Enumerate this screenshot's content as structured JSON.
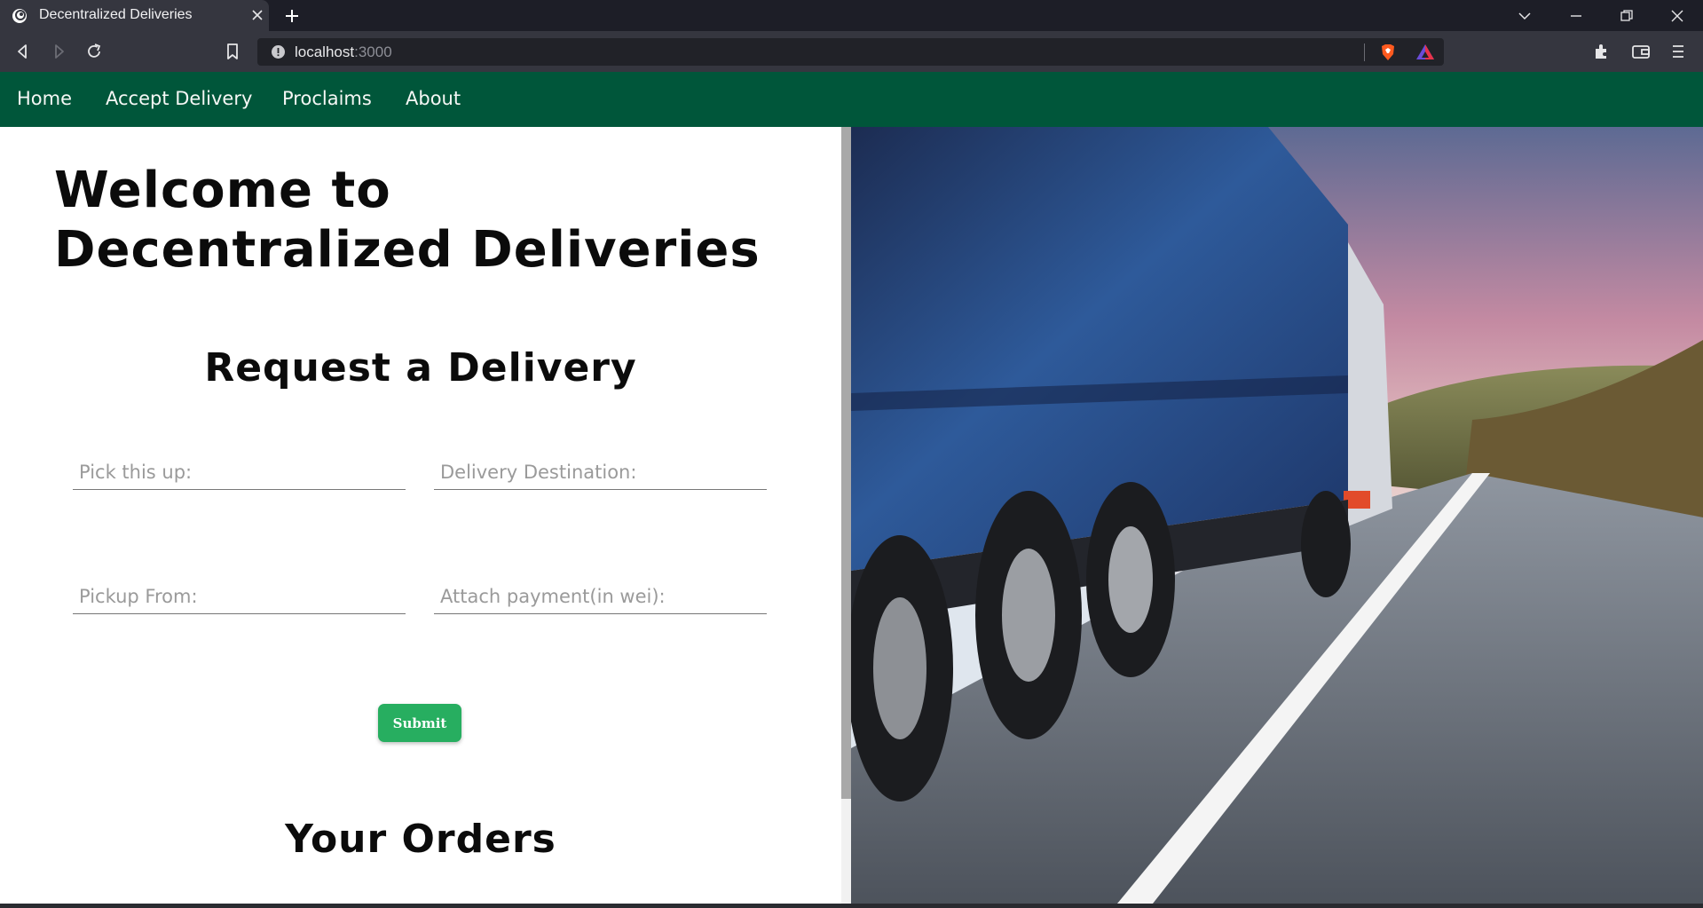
{
  "browser": {
    "tab_title": "Decentralized Deliveries",
    "url_host": "localhost",
    "url_port": ":3000",
    "icons": [
      "favicon-icon",
      "close-icon",
      "plus-icon",
      "chevron-down-icon",
      "minimize-icon",
      "restore-icon",
      "close-window-icon",
      "back-icon",
      "forward-icon",
      "reload-icon",
      "bookmark-icon",
      "info-icon",
      "brave-shield-icon",
      "brave-rewards-icon",
      "extensions-icon",
      "wallet-icon",
      "menu-icon"
    ]
  },
  "nav": {
    "items": [
      "Home",
      "Accept Delivery",
      "Proclaims",
      "About"
    ]
  },
  "page": {
    "welcome": "Welcome to Decentralized Deliveries",
    "request_title": "Request a Delivery",
    "orders_title": "Your Orders"
  },
  "form": {
    "pickup_item_placeholder": "Pick this up:",
    "pickup_item_value": "",
    "destination_placeholder": "Delivery Destination:",
    "destination_value": "",
    "pickup_from_placeholder": "Pickup From:",
    "pickup_from_value": "",
    "payment_placeholder": "Attach payment(in wei):",
    "payment_value": "",
    "submit_label": "Submit"
  },
  "colors": {
    "navbar": "#00563a",
    "submit": "#27ae60",
    "browser_toolbar": "#35363f"
  }
}
